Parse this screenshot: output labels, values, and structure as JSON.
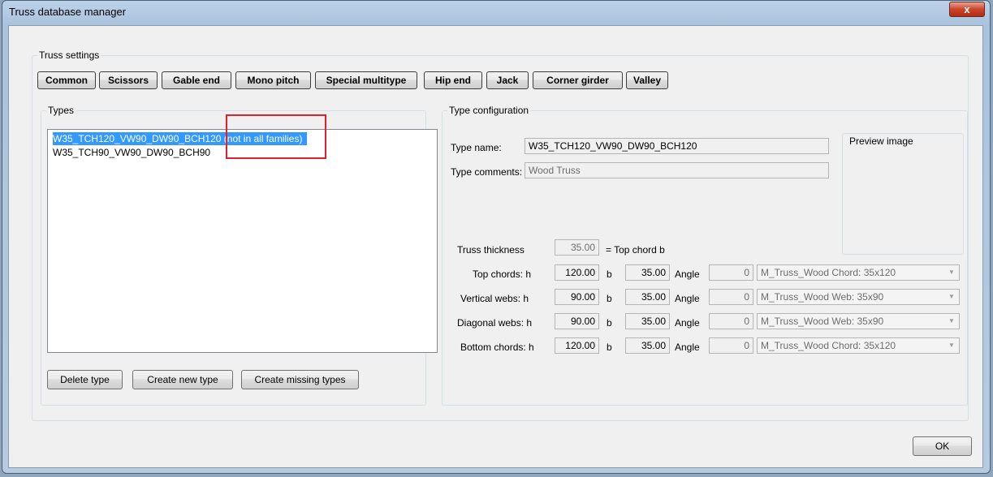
{
  "window": {
    "title": "Truss database manager",
    "close_glyph": "x"
  },
  "truss_settings": {
    "legend": "Truss settings",
    "type_buttons": [
      "Common",
      "Scissors",
      "Gable end",
      "Mono pitch",
      "Special multitype",
      "Hip end",
      "Jack",
      "Corner girder",
      "Valley"
    ]
  },
  "types": {
    "legend": "Types",
    "items": [
      {
        "name": "W35_TCH120_VW90_DW90_BCH120",
        "note": "(not in all families)",
        "selected": true
      },
      {
        "name": "W35_TCH90_VW90_DW90_BCH90",
        "note": "",
        "selected": false
      }
    ],
    "buttons": {
      "delete": "Delete type",
      "create": "Create new type",
      "create_missing": "Create missing types"
    }
  },
  "type_config": {
    "legend": "Type configuration",
    "name_label": "Type name:",
    "name_value": "W35_TCH120_VW90_DW90_BCH120",
    "comments_label": "Type comments:",
    "comments_value": "Wood Truss",
    "preview_label": "Preview image",
    "thickness_label": "Truss thickness",
    "thickness_value": "35.00",
    "thickness_note": "= Top chord b",
    "b_label": "b",
    "angle_label": "Angle",
    "rows": [
      {
        "label": "Top chords: h",
        "h": "120.00",
        "b": "35.00",
        "angle": "0",
        "family": "M_Truss_Wood Chord: 35x120"
      },
      {
        "label": "Vertical webs: h",
        "h": "90.00",
        "b": "35.00",
        "angle": "0",
        "family": "M_Truss_Wood Web: 35x90"
      },
      {
        "label": "Diagonal webs: h",
        "h": "90.00",
        "b": "35.00",
        "angle": "0",
        "family": "M_Truss_Wood Web: 35x90"
      },
      {
        "label": "Bottom chords: h",
        "h": "120.00",
        "b": "35.00",
        "angle": "0",
        "family": "M_Truss_Wood Chord: 35x120"
      }
    ]
  },
  "footer": {
    "ok": "OK"
  },
  "icons": {
    "dropdown": "chevron-down-icon",
    "close": "close-icon"
  }
}
